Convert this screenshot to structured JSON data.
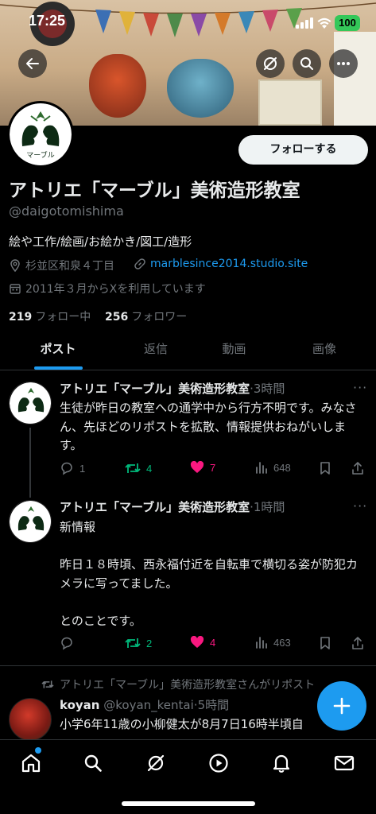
{
  "status_bar": {
    "time": "17:25",
    "battery": "100"
  },
  "header": {
    "back_icon": "arrow-left-icon",
    "grok_icon": "slash-circle-icon",
    "search_icon": "search-icon",
    "more_icon": "ellipsis-icon"
  },
  "profile": {
    "avatar_label": "マーブル",
    "follow_label": "フォローする",
    "name": "アトリエ「マーブル」美術造形教室",
    "handle": "@daigotomishima",
    "bio": "絵や工作/絵画/お絵かき/図工/造形",
    "location": "杉並区和泉４丁目",
    "website": "marblesince2014.studio.site",
    "joined": "2011年３月からXを利用しています",
    "following_count": "219",
    "following_label": "フォロー中",
    "followers_count": "256",
    "followers_label": "フォロワー"
  },
  "tabs": [
    {
      "label": "ポスト",
      "active": true
    },
    {
      "label": "返信",
      "active": false
    },
    {
      "label": "動画",
      "active": false
    },
    {
      "label": "画像",
      "active": false
    }
  ],
  "tweets": [
    {
      "author": "アトリエ「マーブル」美術造形教室",
      "time": "·3時間",
      "text": "生徒が昨日の教室への通学中から行方不明です。みなさん、先ほどのリポストを拡散、情報提供おねがいします。",
      "replies": "1",
      "retweets": "4",
      "likes": "7",
      "views": "648"
    },
    {
      "author": "アトリエ「マーブル」美術造形教室",
      "time": "·1時間",
      "text": "新情報\n\n昨日１８時頃、西永福付近を自転車で横切る姿が防犯カメラに写ってました。\n\nとのことです。",
      "replies": "",
      "retweets": "2",
      "likes": "4",
      "views": "463"
    },
    {
      "retweet_note": "アトリエ「マーブル」美術造形教室さんがリポスト",
      "author": "koyan",
      "handle": "@koyan_kentai",
      "time": "·5時間",
      "text": "小学6年11歳の小柳健太が8月7日16時半頃自"
    }
  ],
  "colors": {
    "accent": "#1d9bf0",
    "retweet": "#00ba7c",
    "like": "#f91880",
    "muted": "#71767b"
  },
  "bottom_nav": [
    "home-icon",
    "search-icon",
    "grok-icon",
    "play-icon",
    "bell-icon",
    "mail-icon"
  ]
}
